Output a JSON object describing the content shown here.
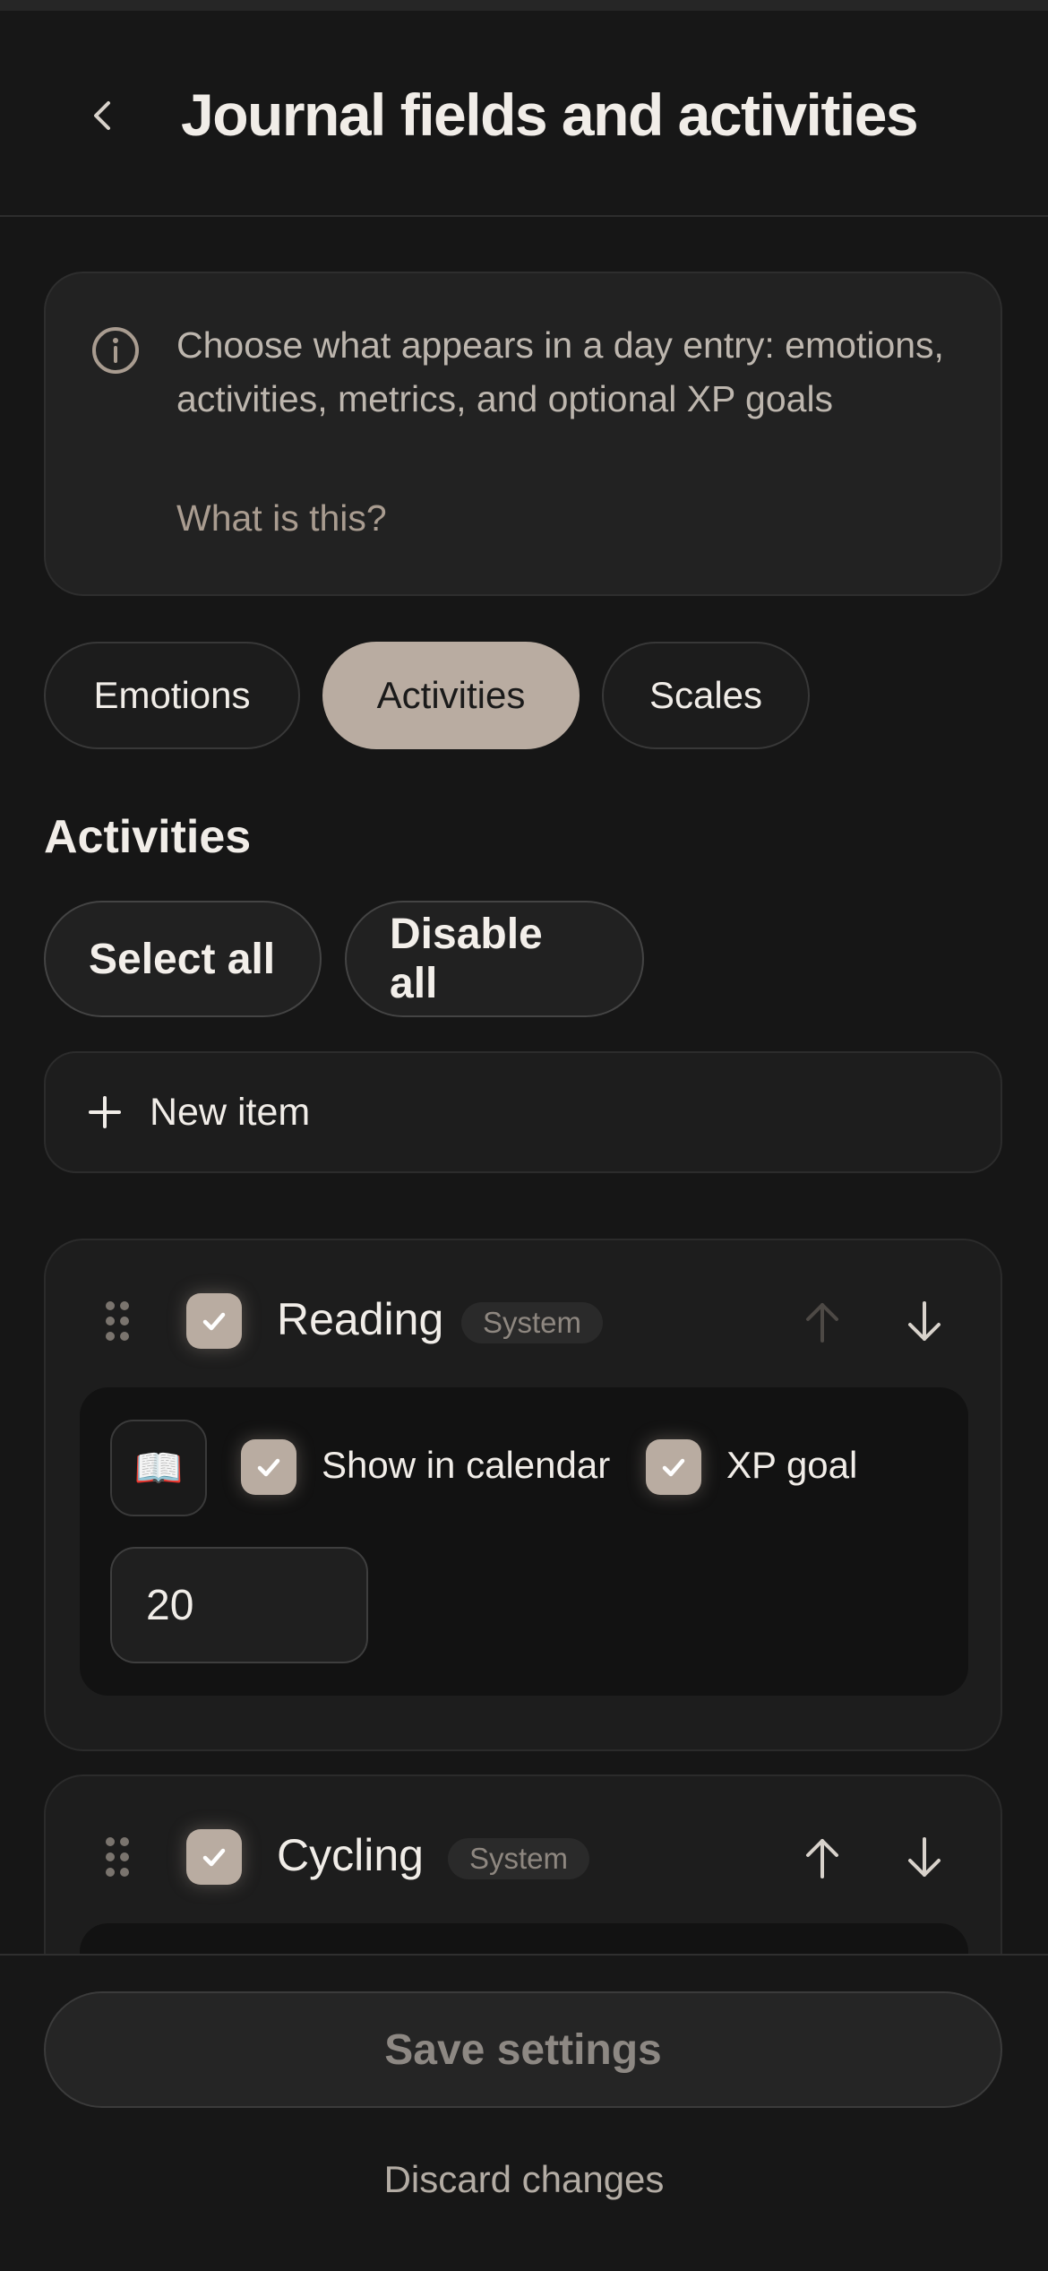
{
  "header": {
    "title": "Journal fields and activities"
  },
  "info": {
    "text": "Choose what appears in a day entry: emotions, activities, metrics, and optional XP goals",
    "link": "What is this?"
  },
  "tabs": [
    {
      "label": "Emotions",
      "active": false
    },
    {
      "label": "Activities",
      "active": true
    },
    {
      "label": "Scales",
      "active": false
    }
  ],
  "section": {
    "title": "Activities",
    "select_all": "Select all",
    "disable_all": "Disable all",
    "new_item": "New item"
  },
  "items": [
    {
      "name": "Reading",
      "badge": "System",
      "enabled": true,
      "emoji": "📖",
      "show_in_calendar_label": "Show in calendar",
      "show_in_calendar": true,
      "xp_goal_label": "XP goal",
      "xp_goal_enabled": true,
      "xp_goal_value": "20"
    },
    {
      "name": "Cycling",
      "badge": "System",
      "enabled": true
    }
  ],
  "footer": {
    "save": "Save settings",
    "discard": "Discard changes"
  },
  "colors": {
    "accent": "#b9aca1",
    "background": "#161616",
    "card": "#1d1d1d"
  }
}
